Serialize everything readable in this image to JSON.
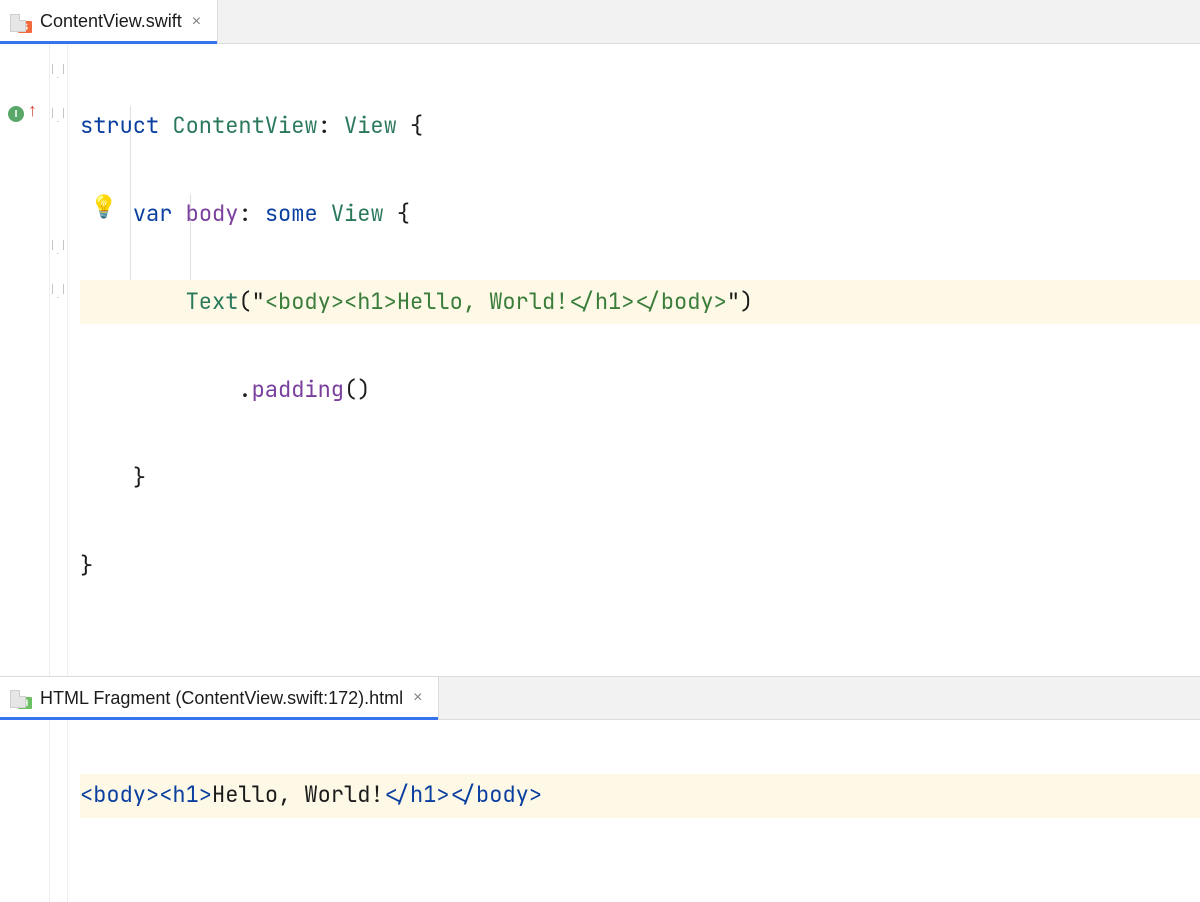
{
  "top": {
    "tab": {
      "filename": "ContentView.swift",
      "icon_letter": "S"
    },
    "code": {
      "l1": {
        "kw": "struct",
        "name": "ContentView",
        "colon": ": ",
        "protocol": "View",
        "brace": " {"
      },
      "l2": {
        "indent": "    ",
        "kw": "var",
        "name": " body",
        "colon": ": ",
        "kw2": "some",
        "type": " View",
        "brace": " {"
      },
      "l3": {
        "indent": "        ",
        "fn": "Text",
        "open": "(\"",
        "str": "<body><h1>Hello, World!</h1></body>",
        "close": "\")"
      },
      "l4": {
        "indent": "            ",
        "dot": ".",
        "fn": "padding",
        "paren": "()"
      },
      "l5": {
        "indent": "    ",
        "brace": "}"
      },
      "l6": {
        "brace": "}"
      }
    }
  },
  "bottom": {
    "tab": {
      "filename": "HTML Fragment (ContentView.swift:172).html",
      "icon_letter": "H"
    },
    "code": {
      "t1": "<body>",
      "t2": "<h1>",
      "text": "Hello, World!",
      "t3": "</h1>",
      "t4": "</body>"
    }
  }
}
